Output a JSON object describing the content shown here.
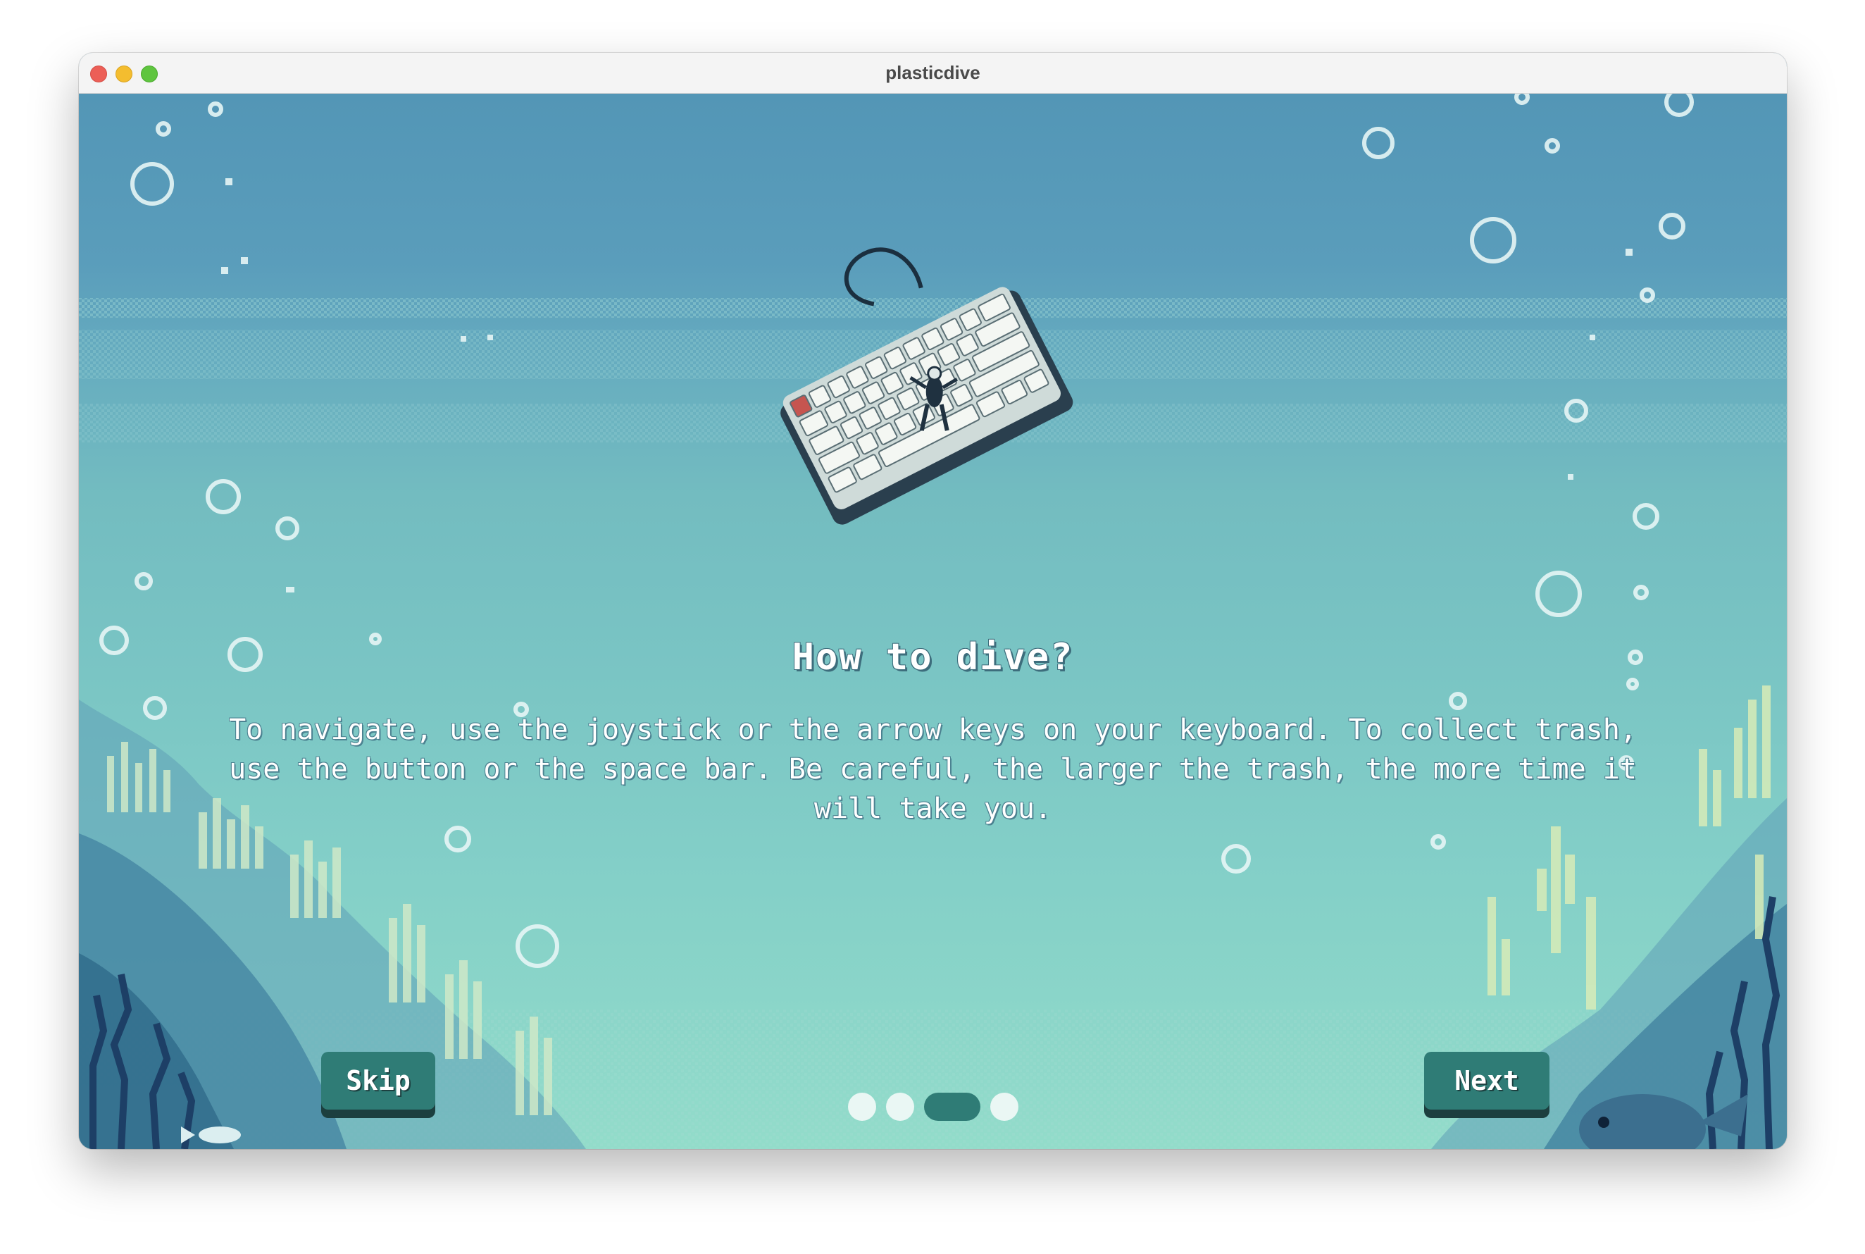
{
  "window": {
    "title": "plasticdive"
  },
  "onboarding": {
    "heading": "How to dive?",
    "body": "To navigate, use the joystick or the arrow keys on your keyboard. To collect trash, use the button or the space bar. Be careful, the larger the trash, the more time it will take you.",
    "illustration": "keyboard-with-diver",
    "skip_label": "Skip",
    "next_label": "Next",
    "pagination": {
      "total": 4,
      "current": 3
    }
  },
  "colors": {
    "button": "#2f7c76",
    "button_shadow": "#1c3f3f",
    "dot_inactive": "#eaf7f4",
    "water_top": "#5396b6",
    "water_bottom": "#93dcca"
  }
}
